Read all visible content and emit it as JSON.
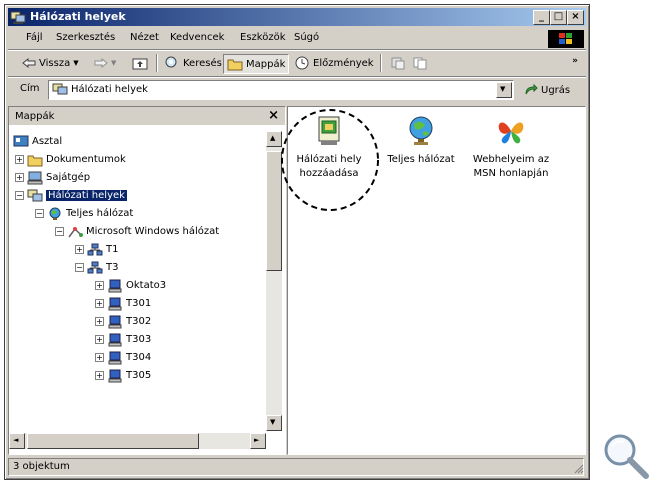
{
  "window": {
    "title": "Hálózati helyek"
  },
  "menu": [
    "Fájl",
    "Szerkesztés",
    "Nézet",
    "Kedvencek",
    "Eszközök",
    "Súgó"
  ],
  "toolbar": {
    "back": "Vissza",
    "search": "Keresés",
    "folders": "Mappák",
    "history": "Előzmények"
  },
  "address": {
    "label": "Cím",
    "value": "Hálózati helyek",
    "go": "Ugrás"
  },
  "folders_pane": {
    "title": "Mappák",
    "tree": [
      "Asztal",
      "Dokumentumok",
      "Sajátgép",
      "Hálózati helyek",
      "Teljes hálózat",
      "Microsoft Windows hálózat",
      "T1",
      "T3",
      "Oktato3",
      "T301",
      "T302",
      "T303",
      "T304",
      "T305"
    ]
  },
  "content": {
    "items": [
      {
        "line1": "Hálózati hely",
        "line2": "hozzáadása",
        "icon": "add-network-place-icon"
      },
      {
        "line1": "Teljes hálózat",
        "line2": "",
        "icon": "globe-icon"
      },
      {
        "line1": "Webhelyeim az",
        "line2": "MSN honlapján",
        "icon": "msn-butterfly-icon"
      }
    ]
  },
  "status": {
    "text": "3 objektum"
  },
  "colors": {
    "titlebar_start": "#0a246a",
    "titlebar_end": "#a6caf0",
    "selection": "#0a246a",
    "chrome": "#d4d0c8"
  }
}
